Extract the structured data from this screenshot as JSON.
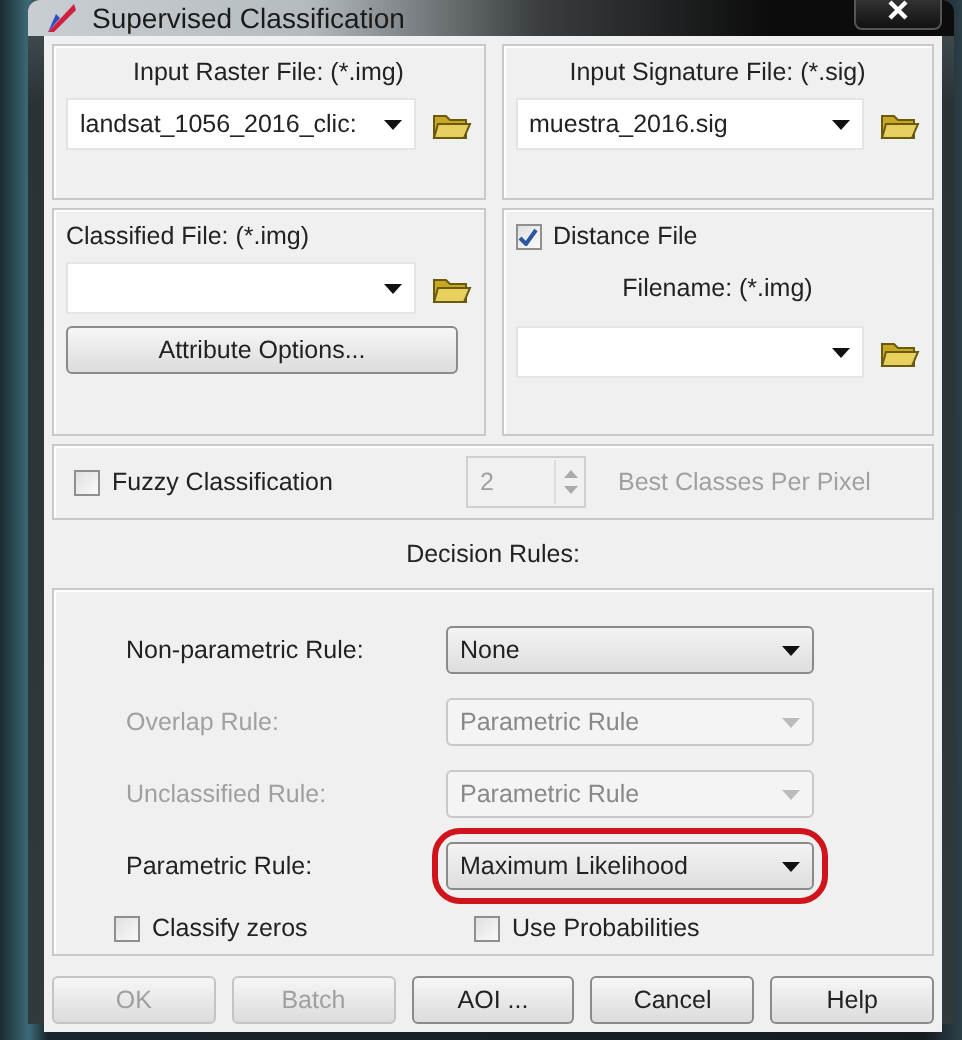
{
  "window": {
    "title": "Supervised Classification"
  },
  "input_raster": {
    "label": "Input Raster File: (*.img)",
    "value": "landsat_1056_2016_clic:"
  },
  "input_signature": {
    "label": "Input Signature File: (*.sig)",
    "value": "muestra_2016.sig"
  },
  "classified_file": {
    "label": "Classified File: (*.img)"
  },
  "attribute_button": {
    "label": "Attribute Options..."
  },
  "distance_file": {
    "label": "Distance File",
    "checked": true,
    "filename_label": "Filename: (*.img)"
  },
  "fuzzy": {
    "label": "Fuzzy Classification",
    "checked": false,
    "count": "2",
    "suffix": "Best Classes Per Pixel"
  },
  "decision_rules": {
    "title": "Decision Rules:",
    "rules": [
      {
        "label": "Non-parametric Rule:",
        "value": "None",
        "disabled": false,
        "highlighted": false
      },
      {
        "label": "Overlap Rule:",
        "value": "Parametric Rule",
        "disabled": true,
        "highlighted": false
      },
      {
        "label": "Unclassified Rule:",
        "value": "Parametric Rule",
        "disabled": true,
        "highlighted": false
      },
      {
        "label": "Parametric Rule:",
        "value": "Maximum Likelihood",
        "disabled": false,
        "highlighted": true
      }
    ],
    "options": [
      {
        "label": "Classify zeros",
        "checked": false
      },
      {
        "label": "Use Probabilities",
        "checked": false
      }
    ]
  },
  "buttons": [
    {
      "label": "OK",
      "disabled": true
    },
    {
      "label": "Batch",
      "disabled": true
    },
    {
      "label": "AOI ...",
      "disabled": false
    },
    {
      "label": "Cancel",
      "disabled": false
    },
    {
      "label": "Help",
      "disabled": false
    }
  ]
}
